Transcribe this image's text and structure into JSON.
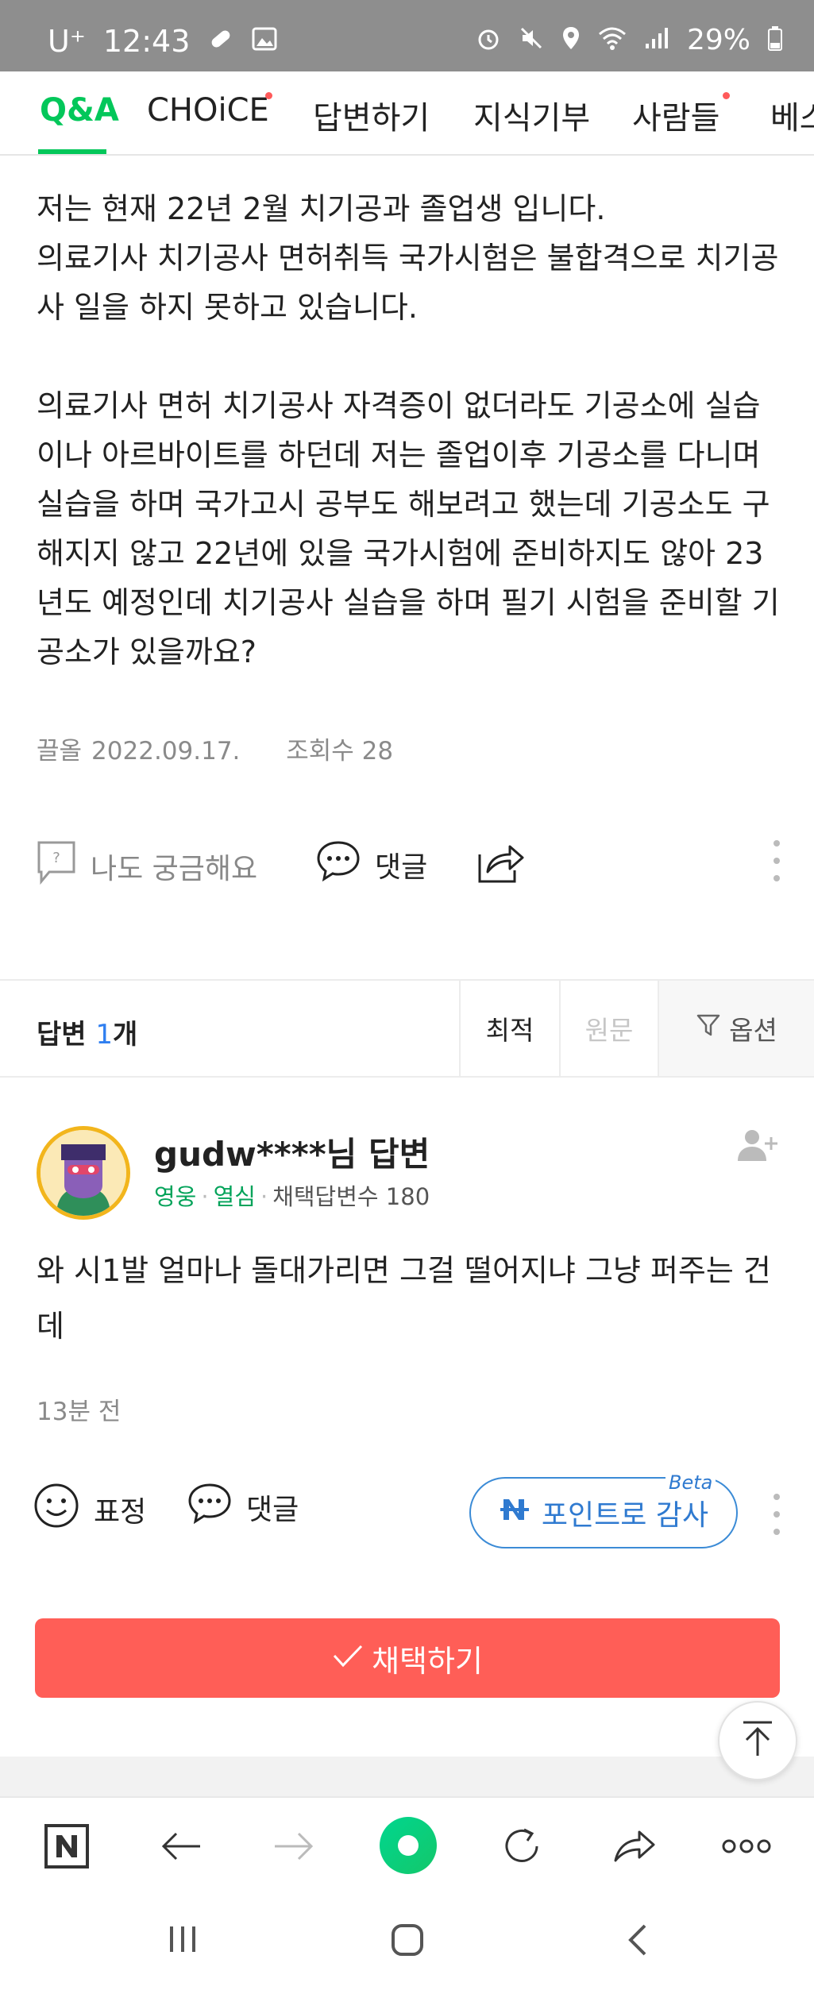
{
  "status_bar": {
    "carrier": "U⁺",
    "time": "12:43",
    "battery": "29%"
  },
  "tabs": [
    {
      "label": "Q&A",
      "active": true
    },
    {
      "label": "CHOiCE",
      "dot": true
    },
    {
      "label": "답변하기"
    },
    {
      "label": "지식기부"
    },
    {
      "label": "사람들",
      "dot": true
    },
    {
      "label": "베스"
    }
  ],
  "question": {
    "body": "저는 현재 22년 2월 치기공과 졸업생 입니다.\n의료기사 치기공사 면허취득 국가시험은 불합격으로 치기공사 일을 하지 못하고 있습니다.\n\n의료기사 면허 치기공사 자격증이 없더라도 기공소에 실습이나 아르바이트를 하던데 저는 졸업이후 기공소를 다니며 실습을 하며 국가고시 공부도 해보려고 했는데 기공소도 구해지지 않고 22년에 있을 국가시험에 준비하지도 않아 23년도 예정인데 치기공사 실습을 하며 필기 시험을 준비할 기공소가 있을까요?",
    "author": "끌올",
    "date": "2022.09.17.",
    "views": "조회수 28",
    "actions": {
      "curious": "나도 궁금해요",
      "comment": "댓글"
    }
  },
  "answers_header": {
    "label": "답변",
    "count": "1",
    "unit": "개",
    "sort_latest": "최적",
    "sort_original": "원문",
    "options": "옵션"
  },
  "answer": {
    "name": "gudw****님 답변",
    "rank1": "영웅",
    "rank2": "열심",
    "adopted_label": "채택답변수 180",
    "body": "와 시1발 얼마나 돌대가리면 그걸 떨어지냐 그냥 퍼주는 건데",
    "time": "13분 전",
    "actions": {
      "emotion": "표정",
      "comment": "댓글",
      "thanks": "포인트로 감사",
      "beta": "Beta"
    },
    "adopt": "채택하기"
  },
  "colors": {
    "accent_green": "#03c75a",
    "adopt_red": "#ff5e57",
    "link_blue": "#2f7ad0"
  }
}
